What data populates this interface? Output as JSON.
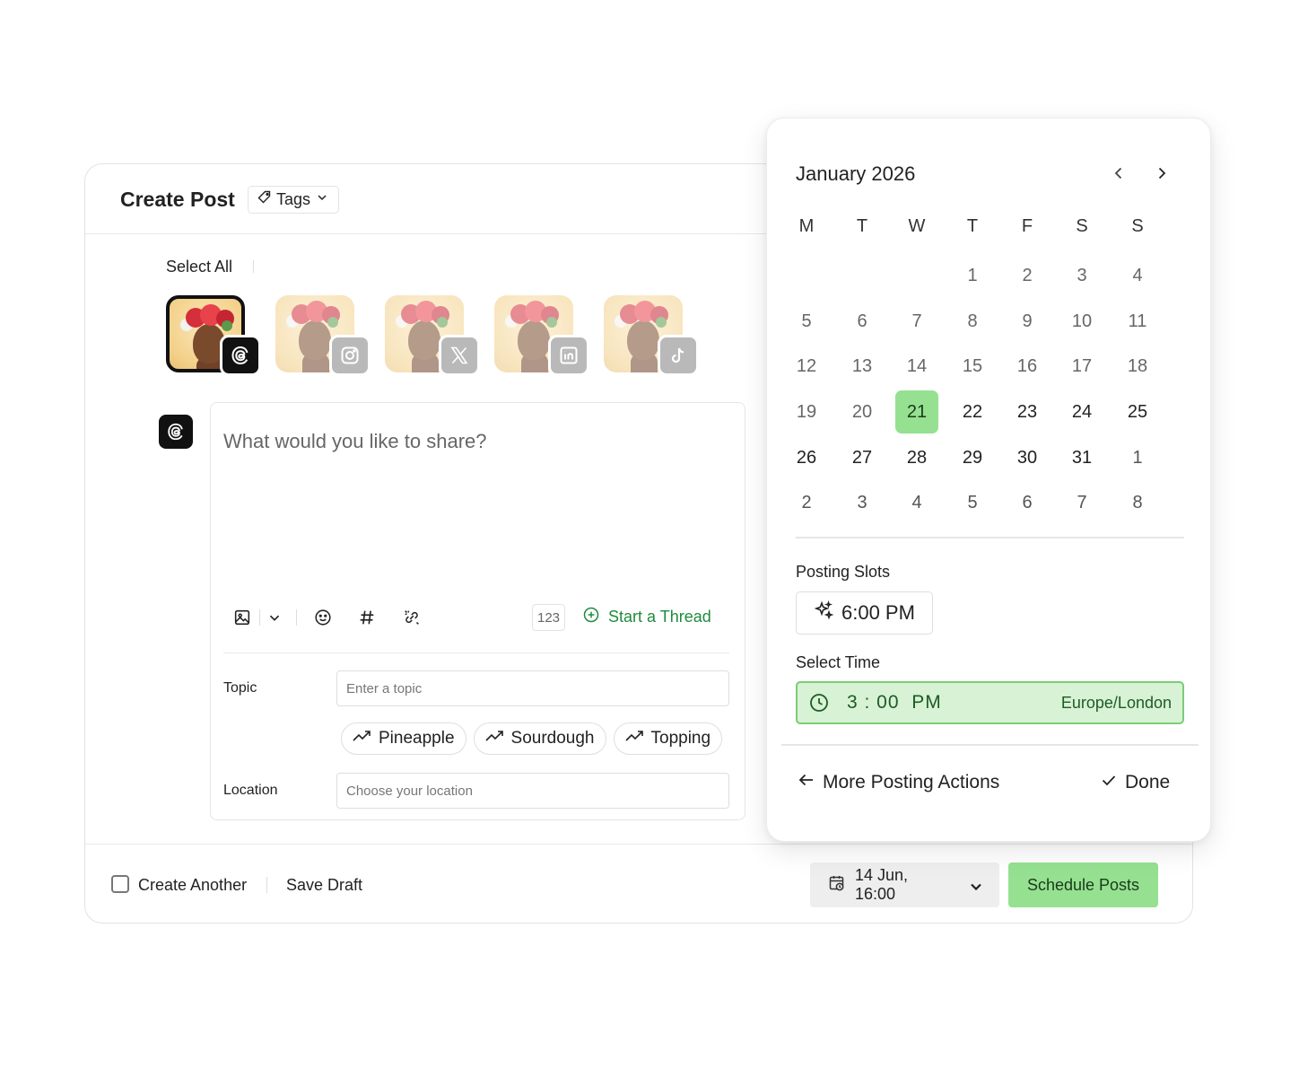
{
  "header": {
    "title": "Create Post",
    "tags_label": "Tags"
  },
  "accounts": {
    "select_all_label": "Select All",
    "items": [
      {
        "platform": "threads",
        "icon": "threads-icon",
        "selected": true
      },
      {
        "platform": "instagram",
        "icon": "instagram-icon",
        "selected": false
      },
      {
        "platform": "x",
        "icon": "x-logo-icon",
        "selected": false
      },
      {
        "platform": "linkedin",
        "icon": "linkedin-icon",
        "selected": false
      },
      {
        "platform": "tiktok",
        "icon": "tiktok-icon",
        "selected": false
      }
    ]
  },
  "composer": {
    "placeholder": "What would you like to share?",
    "char_counter": "123",
    "start_thread_label": "Start a Thread",
    "toolbar_icons": [
      "image-icon",
      "chevron-down-icon",
      "emoji-icon",
      "hashtag-icon",
      "link-icon"
    ],
    "topic_label": "Topic",
    "topic_placeholder": "Enter a topic",
    "topic_suggestions": [
      "Pineapple",
      "Sourdough",
      "Topping"
    ],
    "location_label": "Location",
    "location_placeholder": "Choose your location"
  },
  "footer": {
    "create_another_label": "Create Another",
    "save_draft_label": "Save Draft",
    "date_value": "14 Jun, 16:00",
    "schedule_label": "Schedule Posts"
  },
  "calendar": {
    "month_label": "January 2026",
    "weekdays": [
      "M",
      "T",
      "W",
      "T",
      "F",
      "S",
      "S"
    ],
    "weeks": [
      [
        "",
        "",
        "",
        "1",
        "2",
        "3",
        "4"
      ],
      [
        "5",
        "6",
        "7",
        "8",
        "9",
        "10",
        "11"
      ],
      [
        "12",
        "13",
        "14",
        "15",
        "16",
        "17",
        "18"
      ],
      [
        "19",
        "20",
        "21",
        "22",
        "23",
        "24",
        "25"
      ],
      [
        "26",
        "27",
        "28",
        "29",
        "30",
        "31",
        "1"
      ],
      [
        "2",
        "3",
        "4",
        "5",
        "6",
        "7",
        "8"
      ]
    ],
    "selected_day": "21",
    "posting_slots_label": "Posting Slots",
    "slot_time": "6:00 PM",
    "select_time_label": "Select Time",
    "time_value": "3 : 00  PM",
    "timezone": "Europe/London",
    "more_actions_label": "More Posting Actions",
    "done_label": "Done"
  },
  "colors": {
    "accent_green": "#95e191",
    "accent_green_text": "#1f8b3e",
    "time_field_bg": "#d7f2d4"
  }
}
